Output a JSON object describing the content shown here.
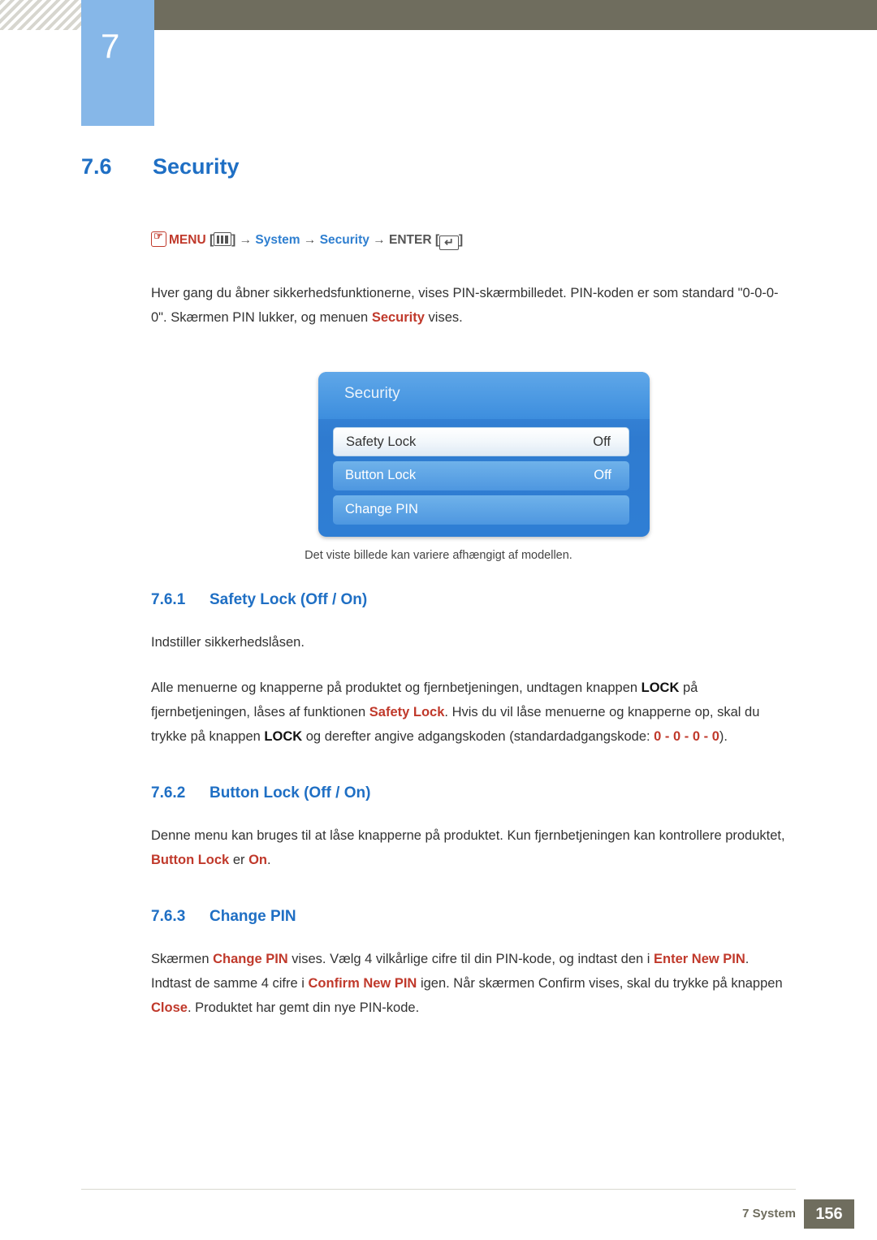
{
  "header": {
    "chapter_number": "7",
    "chapter_title": "System"
  },
  "section": {
    "number": "7.6",
    "title": "Security"
  },
  "menu_path": {
    "hand_icon": "hand-pointer-icon",
    "menu_label": "MENU",
    "menu_icon": "menu-bars-icon",
    "arrow1": "→",
    "item1": "System",
    "arrow2": "→",
    "item2": "Security",
    "arrow3": "→",
    "enter_label": "ENTER",
    "enter_icon": "enter-key-icon"
  },
  "intro": {
    "line1_a": "Hver gang du åbner sikkerhedsfunktionerne, vises PIN-skærmbilledet. PIN-koden er som standard \"0-0-",
    "line2_a": "0-0\". Skærmen PIN lukker, og menuen ",
    "line2_b": "Security",
    "line2_c": " vises."
  },
  "osd": {
    "title": "Security",
    "rows": [
      {
        "label": "Safety Lock",
        "value": "Off",
        "selected": true
      },
      {
        "label": "Button Lock",
        "value": "Off",
        "selected": false
      },
      {
        "label": "Change PIN",
        "value": "",
        "selected": false
      }
    ],
    "caption": "Det viste billede kan variere afhængigt af modellen."
  },
  "subsections": [
    {
      "number": "7.6.1",
      "title": "Safety Lock (Off / On)",
      "p1": "Indstiller sikkerhedslåsen.",
      "p2_part1": "Alle menuerne og knapperne på produktet og fjernbetjeningen, undtagen knappen ",
      "p2_lock1": "LOCK",
      "p2_part2": " på fjernbetjeningen, låses af funktionen ",
      "p2_safety": "Safety Lock",
      "p2_part3": ". Hvis du vil låse menuerne og knapperne op, skal du trykke på knappen ",
      "p2_lock2": "LOCK",
      "p2_part4": " og derefter angive adgangskoden (standardadgangskode: ",
      "p2_code": "0 - 0 - 0 - 0",
      "p2_part5": ")."
    },
    {
      "number": "7.6.2",
      "title": "Button Lock (Off / On)",
      "p1_part1": "Denne menu kan bruges til at låse knapperne på produktet. Kun fjernbetjeningen kan kontrollere produktet, ",
      "p1_button": "Button Lock",
      "p1_part2": " er ",
      "p1_on": "On",
      "p1_part3": "."
    },
    {
      "number": "7.6.3",
      "title": "Change PIN",
      "p1_part1": "Skærmen ",
      "p1_change": "Change PIN",
      "p1_part2": " vises. Vælg 4 vilkårlige cifre til din PIN-kode, og indtast den i ",
      "p1_enter": "Enter New PIN",
      "p1_part3": ". Indtast de samme 4 cifre i ",
      "p1_confirm": "Confirm New PIN",
      "p1_part4": " igen. Når skærmen Confirm vises, skal du trykke på knappen ",
      "p1_close": "Close",
      "p1_part5": ". Produktet har gemt din nye PIN-kode."
    }
  ],
  "footer": {
    "label": "7 System",
    "page": "156"
  },
  "colors": {
    "header_bar": "#6f6d5e",
    "chapter_tab": "#86b7e8",
    "heading_blue": "#1f6fc4",
    "accent_red": "#c0392b"
  }
}
